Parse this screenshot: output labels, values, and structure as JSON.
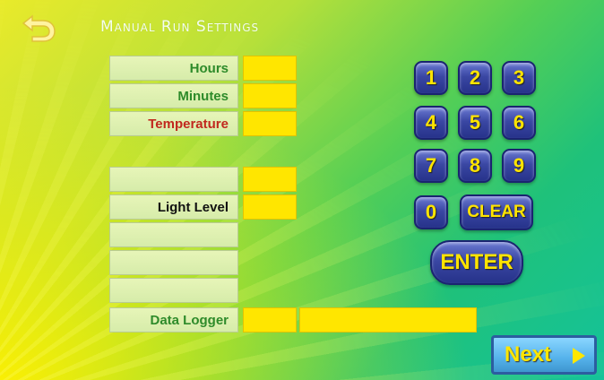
{
  "header": {
    "title": "Manual Run Settings",
    "back_icon": "back-arrow-icon"
  },
  "fields": {
    "hours": {
      "label": "Hours",
      "value": ""
    },
    "minutes": {
      "label": "Minutes",
      "value": ""
    },
    "temperature": {
      "label": "Temperature",
      "value": ""
    },
    "blank_row_1": {
      "label": "",
      "value": ""
    },
    "light_level": {
      "label": "Light Level",
      "value": ""
    },
    "blank_row_2": {
      "label": ""
    },
    "blank_row_3": {
      "label": ""
    },
    "blank_row_4": {
      "label": ""
    },
    "data_logger": {
      "label": "Data Logger",
      "value": "",
      "detail": ""
    }
  },
  "keypad": {
    "keys": [
      "1",
      "2",
      "3",
      "4",
      "5",
      "6",
      "7",
      "8",
      "9",
      "0"
    ],
    "clear": "CLEAR",
    "enter": "ENTER"
  },
  "footer": {
    "next": "Next"
  },
  "colors": {
    "label_green": "#2e8b2a",
    "label_red": "#c1281e",
    "value_yellow": "#ffe600",
    "key_blue": "#3a47a3",
    "key_text": "#ffe400"
  }
}
